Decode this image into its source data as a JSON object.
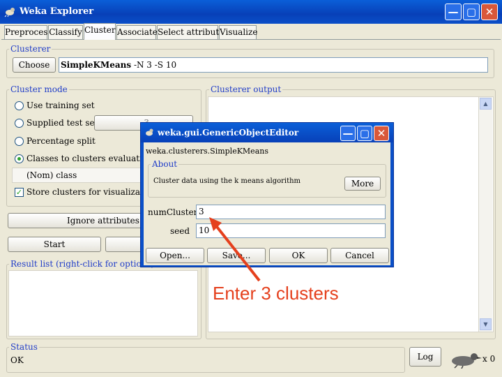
{
  "window": {
    "title": "Weka Explorer",
    "min_glyph": "—",
    "max_glyph": "▢",
    "close_glyph": "✕"
  },
  "tabs": [
    "Preprocess",
    "Classify",
    "Cluster",
    "Associate",
    "Select attributes",
    "Visualize"
  ],
  "clusterer": {
    "group_label": "Clusterer",
    "choose_label": "Choose",
    "algo_name": "SimpleKMeans",
    "algo_args": "-N 3 -S 10"
  },
  "cluster_mode": {
    "group_label": "Cluster mode",
    "options": [
      "Use training set",
      "Supplied test set",
      "Percentage split",
      "Classes to clusters evaluation"
    ],
    "selected_index": 3,
    "percentage_value": "3",
    "class_select": "(Nom) class",
    "store_clusters_label": "Store clusters for visualization",
    "store_clusters_checked": true
  },
  "ignore_attributes_label": "Ignore attributes",
  "start_label": "Start",
  "result_list_label": "Result list (right-click for options)",
  "clusterer_output_label": "Clusterer output",
  "status": {
    "group_label": "Status",
    "text": "OK",
    "log_label": "Log",
    "count_text": "x 0"
  },
  "dialog": {
    "title": "weka.gui.GenericObjectEditor",
    "class_name": "weka.clusterers.SimpleKMeans",
    "about_label": "About",
    "about_text": "Cluster data using the k means algorithm",
    "more_label": "More",
    "fields": [
      {
        "label": "numClusters",
        "value": "3"
      },
      {
        "label": "seed",
        "value": "10"
      }
    ],
    "buttons": [
      "Open...",
      "Save...",
      "OK",
      "Cancel"
    ]
  },
  "annotation": "Enter 3 clusters",
  "colors": {
    "title_bar": "#0A4FC8",
    "group_label": "#1F3CC8",
    "annotation": "#E5401D",
    "close_button": "#D9583A"
  }
}
